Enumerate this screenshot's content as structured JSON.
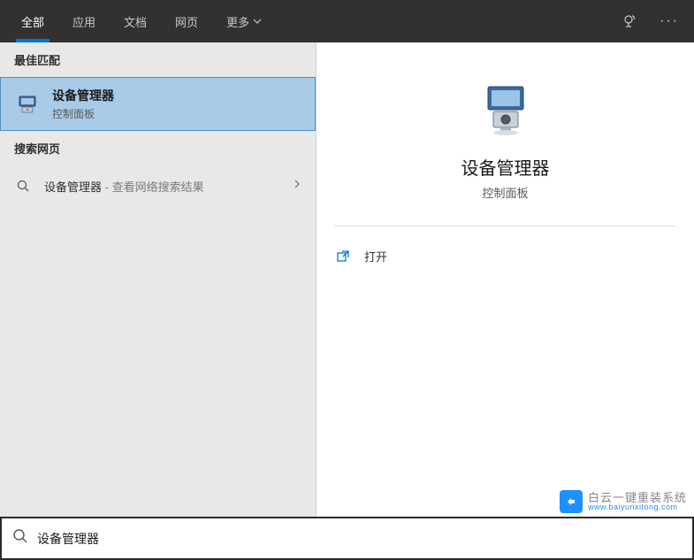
{
  "header": {
    "tabs": [
      {
        "label": "全部",
        "active": true
      },
      {
        "label": "应用",
        "active": false
      },
      {
        "label": "文档",
        "active": false
      },
      {
        "label": "网页",
        "active": false
      }
    ],
    "more_label": "更多"
  },
  "left": {
    "best_match_header": "最佳匹配",
    "selected_result": {
      "title": "设备管理器",
      "subtitle": "控制面板"
    },
    "web_header": "搜索网页",
    "web_result": {
      "query": "设备管理器",
      "suffix": " - 查看网络搜索结果"
    }
  },
  "detail": {
    "title": "设备管理器",
    "subtitle": "控制面板",
    "actions": [
      {
        "label": "打开",
        "icon": "open"
      }
    ]
  },
  "search": {
    "value": "设备管理器",
    "placeholder": ""
  },
  "watermark": {
    "title": "白云一键重装系统",
    "url": "www.baiyunxitong.com"
  }
}
